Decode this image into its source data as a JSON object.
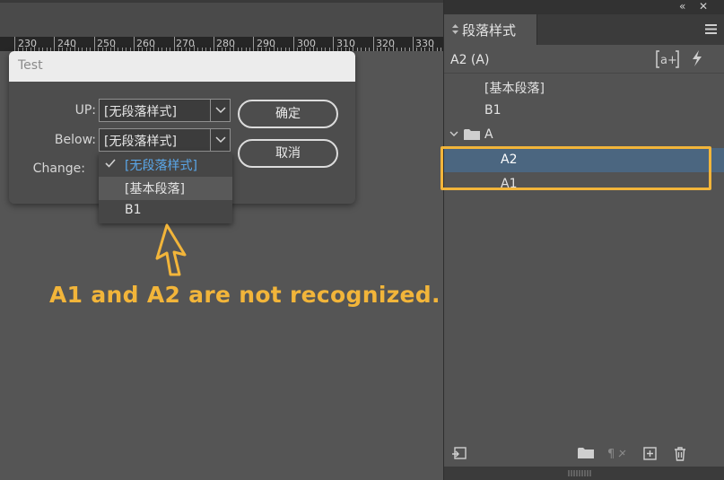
{
  "ruler": {
    "labels": [
      "230",
      "240",
      "250",
      "260",
      "270",
      "280",
      "290",
      "300",
      "310",
      "320",
      "330"
    ]
  },
  "dialog": {
    "title": "Test",
    "up_label": "UP:",
    "up_value": "[无段落样式]",
    "below_label": "Below:",
    "below_value": "[无段落样式]",
    "change_label": "Change:",
    "ok_button": "确定",
    "cancel_button": "取消"
  },
  "dropdown": {
    "items": [
      {
        "label": "[无段落样式]",
        "state": "selected"
      },
      {
        "label": "[基本段落]",
        "state": "hover"
      },
      {
        "label": "B1",
        "state": "normal"
      }
    ]
  },
  "annotation": {
    "text": "A1 and A2 are not recognized.",
    "color": "#f2b53a"
  },
  "panel": {
    "collapse_icon": "double-chevron-left-icon",
    "close_icon": "close-icon",
    "tab_title": "段落样式",
    "current_style": "A2 (A)",
    "list": [
      {
        "label": "[基本段落]",
        "level": 1
      },
      {
        "label": "B1",
        "level": 1
      },
      {
        "label": "A",
        "level": 0,
        "type": "group"
      },
      {
        "label": "A2",
        "level": 2,
        "selected": true
      },
      {
        "label": "A1",
        "level": 2
      }
    ],
    "selection_color": "#4b6680"
  }
}
